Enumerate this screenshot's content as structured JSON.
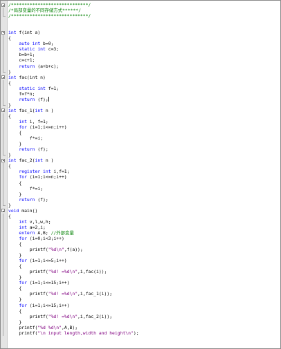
{
  "editor": {
    "lines": [
      {
        "f": "open",
        "s": [
          [
            "/*****************************/",
            "cm"
          ]
        ]
      },
      {
        "f": "inner",
        "s": [
          [
            "/*局部变量的不同存储方式******/",
            "cm"
          ]
        ]
      },
      {
        "f": "close",
        "s": [
          [
            "/*****************************/",
            "cm"
          ]
        ]
      },
      {
        "f": "",
        "s": []
      },
      {
        "f": "",
        "s": []
      },
      {
        "f": "open",
        "s": [
          [
            "int",
            "kw"
          ],
          [
            " f(int a)",
            ""
          ]
        ]
      },
      {
        "f": "inner",
        "s": [
          [
            "{",
            ""
          ]
        ]
      },
      {
        "f": "inner",
        "s": [
          [
            "    ",
            ""
          ],
          [
            "auto int",
            "kw"
          ],
          [
            " b=0;",
            ""
          ]
        ]
      },
      {
        "f": "inner",
        "s": [
          [
            "    ",
            ""
          ],
          [
            "static int",
            "kw"
          ],
          [
            " c=3;",
            ""
          ]
        ]
      },
      {
        "f": "inner",
        "s": [
          [
            "    b=b+1;",
            ""
          ]
        ]
      },
      {
        "f": "inner",
        "s": [
          [
            "    c=c+1;",
            ""
          ]
        ]
      },
      {
        "f": "inner",
        "s": [
          [
            "    ",
            ""
          ],
          [
            "return",
            "kw"
          ],
          [
            " (a+b+c);",
            ""
          ]
        ]
      },
      {
        "f": "close",
        "s": [
          [
            "}",
            ""
          ]
        ]
      },
      {
        "f": "open",
        "s": [
          [
            "int",
            "kw"
          ],
          [
            " fac(int n)",
            ""
          ]
        ]
      },
      {
        "f": "inner",
        "s": [
          [
            "{",
            ""
          ]
        ]
      },
      {
        "f": "inner",
        "s": [
          [
            "    ",
            ""
          ],
          [
            "static int",
            "kw"
          ],
          [
            " f=1;",
            ""
          ]
        ]
      },
      {
        "f": "inner",
        "s": [
          [
            "    f=f*n;",
            ""
          ]
        ]
      },
      {
        "f": "inner",
        "s": [
          [
            "    ",
            ""
          ],
          [
            "return",
            "kw"
          ],
          [
            " (f);",
            ""
          ],
          [
            "|",
            "caret"
          ]
        ]
      },
      {
        "f": "close",
        "s": [
          [
            "}",
            ""
          ]
        ]
      },
      {
        "f": "open",
        "s": [
          [
            "int",
            "kw"
          ],
          [
            " fac_1(",
            ""
          ],
          [
            "int",
            "kw"
          ],
          [
            " n )",
            ""
          ]
        ]
      },
      {
        "f": "inner",
        "s": [
          [
            "{",
            ""
          ]
        ]
      },
      {
        "f": "inner",
        "s": [
          [
            "    ",
            ""
          ],
          [
            "int",
            "kw"
          ],
          [
            " i, f=1;",
            ""
          ]
        ]
      },
      {
        "f": "inner",
        "s": [
          [
            "    ",
            ""
          ],
          [
            "for",
            "kw"
          ],
          [
            " (i=1;i<=n;i++)",
            ""
          ]
        ]
      },
      {
        "f": "inner",
        "s": [
          [
            "    {",
            ""
          ]
        ]
      },
      {
        "f": "inner",
        "s": [
          [
            "        f*=i;",
            ""
          ]
        ]
      },
      {
        "f": "inner",
        "s": [
          [
            "    }",
            ""
          ]
        ]
      },
      {
        "f": "inner",
        "s": [
          [
            "    ",
            ""
          ],
          [
            "return",
            "kw"
          ],
          [
            " (f);",
            ""
          ]
        ]
      },
      {
        "f": "close",
        "s": [
          [
            "}",
            ""
          ]
        ]
      },
      {
        "f": "open",
        "s": [
          [
            "int",
            "kw"
          ],
          [
            " fac_2(",
            ""
          ],
          [
            "int",
            "kw"
          ],
          [
            " n )",
            ""
          ]
        ]
      },
      {
        "f": "inner",
        "s": [
          [
            "{",
            ""
          ]
        ]
      },
      {
        "f": "inner",
        "s": [
          [
            "    ",
            ""
          ],
          [
            "register int",
            "kw"
          ],
          [
            " i,f=1;",
            ""
          ]
        ]
      },
      {
        "f": "inner",
        "s": [
          [
            "    ",
            ""
          ],
          [
            "for",
            "kw"
          ],
          [
            " (i=1;i<=n;i++)",
            ""
          ]
        ]
      },
      {
        "f": "inner",
        "s": [
          [
            "    {",
            ""
          ]
        ]
      },
      {
        "f": "inner",
        "s": [
          [
            "        f*=i;",
            ""
          ]
        ]
      },
      {
        "f": "inner",
        "s": [
          [
            "    }",
            ""
          ]
        ]
      },
      {
        "f": "inner",
        "s": [
          [
            "    ",
            ""
          ],
          [
            "return",
            "kw"
          ],
          [
            " (f);",
            ""
          ]
        ]
      },
      {
        "f": "close",
        "s": [
          [
            "}",
            ""
          ]
        ]
      },
      {
        "f": "open",
        "s": [
          [
            "void",
            "kw"
          ],
          [
            " main()",
            ""
          ]
        ]
      },
      {
        "f": "inner",
        "s": [
          [
            "{",
            ""
          ]
        ]
      },
      {
        "f": "inner",
        "s": [
          [
            "    ",
            ""
          ],
          [
            "int",
            "kw"
          ],
          [
            " v,l,w,h;",
            ""
          ]
        ]
      },
      {
        "f": "inner",
        "s": [
          [
            "    ",
            ""
          ],
          [
            "int",
            "kw"
          ],
          [
            " a=2,i;",
            ""
          ]
        ]
      },
      {
        "f": "inner",
        "s": [
          [
            "    ",
            ""
          ],
          [
            "extern",
            "kw"
          ],
          [
            " A,B; ",
            ""
          ],
          [
            "//外部变量",
            "cm"
          ]
        ]
      },
      {
        "f": "inner",
        "s": [
          [
            "    ",
            ""
          ],
          [
            "for",
            "kw"
          ],
          [
            " (i=0;i<3;i++)",
            ""
          ]
        ]
      },
      {
        "f": "inner",
        "s": [
          [
            "    {",
            ""
          ]
        ]
      },
      {
        "f": "inner",
        "s": [
          [
            "        printf(",
            ""
          ],
          [
            "\"%d\\n\"",
            "str"
          ],
          [
            ",f(a));",
            ""
          ]
        ]
      },
      {
        "f": "inner",
        "s": [
          [
            "    }",
            ""
          ]
        ]
      },
      {
        "f": "inner",
        "s": [
          [
            "    ",
            ""
          ],
          [
            "for",
            "kw"
          ],
          [
            " (i=1;i<=5;i++)",
            ""
          ]
        ]
      },
      {
        "f": "inner",
        "s": [
          [
            "    {",
            ""
          ]
        ]
      },
      {
        "f": "inner",
        "s": [
          [
            "        printf(",
            ""
          ],
          [
            "\"%d! =%d\\n\"",
            "str"
          ],
          [
            ",i,fac(i));",
            ""
          ]
        ]
      },
      {
        "f": "inner",
        "s": [
          [
            "    }",
            ""
          ]
        ]
      },
      {
        "f": "inner",
        "s": [
          [
            "    ",
            ""
          ],
          [
            "for",
            "kw"
          ],
          [
            " (i=1;i<=15;i++)",
            ""
          ]
        ]
      },
      {
        "f": "inner",
        "s": [
          [
            "    {",
            ""
          ]
        ]
      },
      {
        "f": "inner",
        "s": [
          [
            "        printf(",
            ""
          ],
          [
            "\"%d! =%d\\n\"",
            "str"
          ],
          [
            ",i,fac_1(i));",
            ""
          ]
        ]
      },
      {
        "f": "inner",
        "s": [
          [
            "    }",
            ""
          ]
        ]
      },
      {
        "f": "inner",
        "s": [
          [
            "    ",
            ""
          ],
          [
            "for",
            "kw"
          ],
          [
            " (i=1;i<=15;i++)",
            ""
          ]
        ]
      },
      {
        "f": "inner",
        "s": [
          [
            "    {",
            ""
          ]
        ]
      },
      {
        "f": "inner",
        "s": [
          [
            "        printf(",
            ""
          ],
          [
            "\"%d! =%d\\n\"",
            "str"
          ],
          [
            ",i,fac_2(i));",
            ""
          ]
        ]
      },
      {
        "f": "inner",
        "s": [
          [
            "    }",
            ""
          ]
        ]
      },
      {
        "f": "inner",
        "s": [
          [
            "    printf(",
            ""
          ],
          [
            "\"%d %d\\n\"",
            "str"
          ],
          [
            ",A,B);",
            ""
          ]
        ]
      },
      {
        "f": "inner",
        "s": [
          [
            "    printf(",
            ""
          ],
          [
            "\"\\n input length,width and height\\n\"",
            "str"
          ],
          [
            ");",
            ""
          ]
        ]
      }
    ]
  }
}
